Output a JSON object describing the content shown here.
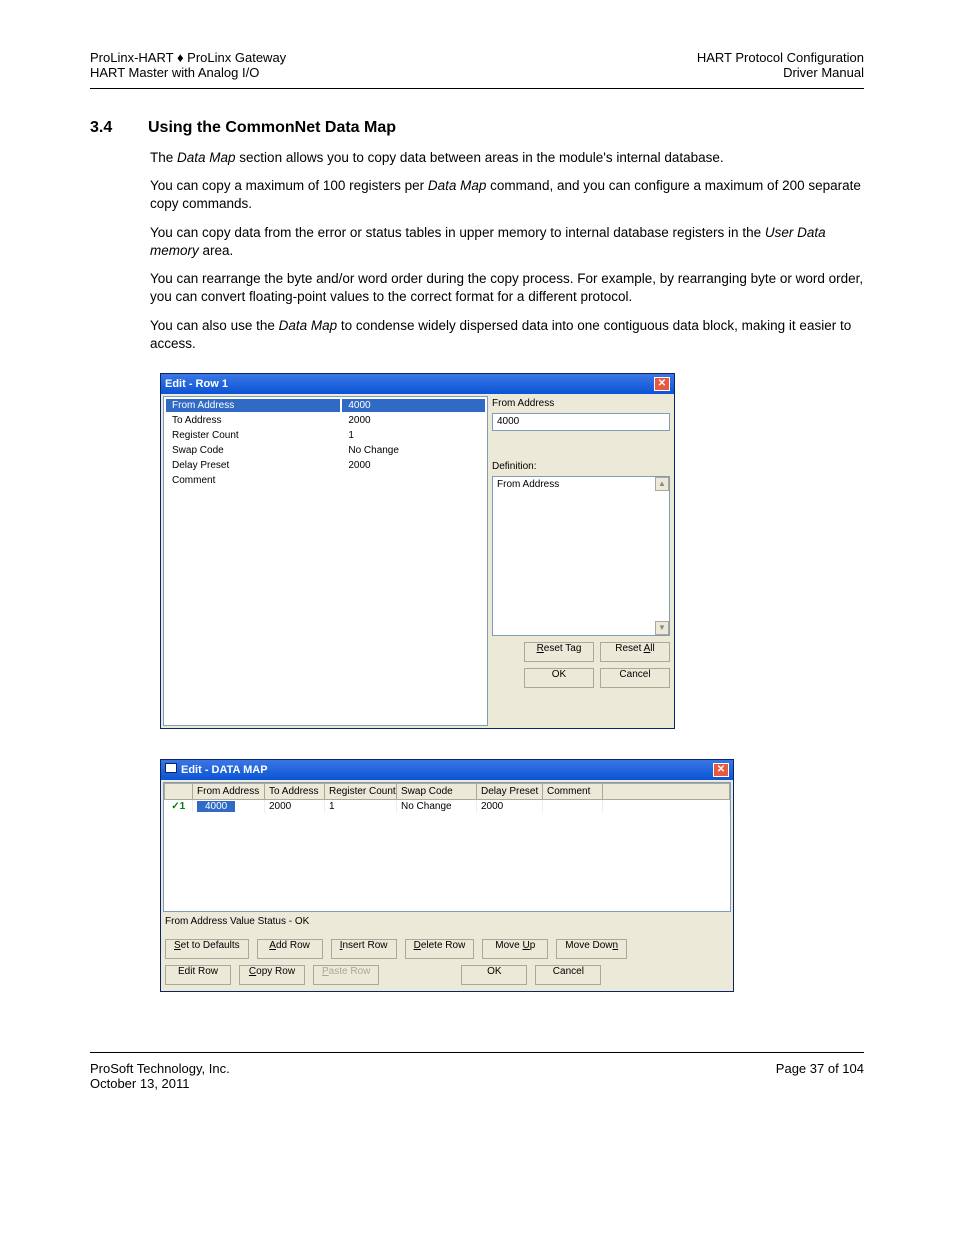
{
  "header": {
    "left1": "ProLinx-HART ♦ ProLinx Gateway",
    "left2": "HART Master with Analog I/O",
    "right1": "HART Protocol Configuration",
    "right2": "Driver Manual"
  },
  "section": {
    "num": "3.4",
    "title": "Using the CommonNet Data Map",
    "p1a": "The ",
    "p1b": "Data Map",
    "p1c": " section allows you to copy data between areas in the module's internal database.",
    "p2a": "You can copy a maximum of 100 registers per ",
    "p2b": "Data Map",
    "p2c": " command, and you can configure a maximum of 200 separate copy commands.",
    "p3a": "You can copy data from the error or status tables in upper memory to internal database registers in the ",
    "p3b": "User Data memory",
    "p3c": " area.",
    "p4": "You can rearrange the byte and/or word order during the copy process. For example, by rearranging byte or word order, you can convert floating-point values to the correct format for a different protocol.",
    "p5a": "You can also use the ",
    "p5b": "Data Map",
    "p5c": " to condense widely dispersed data into one contiguous data block, making it easier to access."
  },
  "dlg1": {
    "title": "Edit - Row 1",
    "props": [
      {
        "k": "From Address",
        "v": "4000"
      },
      {
        "k": "To Address",
        "v": "2000"
      },
      {
        "k": "Register Count",
        "v": "1"
      },
      {
        "k": "Swap Code",
        "v": "No Change"
      },
      {
        "k": "Delay Preset",
        "v": "2000"
      },
      {
        "k": "Comment",
        "v": ""
      }
    ],
    "field_label": "From Address",
    "field_value": "4000",
    "def_label": "Definition:",
    "def_value": "From Address",
    "btn_reset_tag": "Reset Tag",
    "btn_reset_all": "Reset All",
    "btn_ok": "OK",
    "btn_cancel": "Cancel"
  },
  "dlg2": {
    "title": "Edit - DATA MAP",
    "cols": [
      "",
      "From Address",
      "To Address",
      "Register Count",
      "Swap Code",
      "Delay Preset",
      "Comment",
      ""
    ],
    "row": {
      "n": "1",
      "from": "4000",
      "to": "2000",
      "reg": "1",
      "swap": "No Change",
      "delay": "2000",
      "comment": ""
    },
    "status": "From Address Value Status - OK",
    "btns1": {
      "set": "Set to Defaults",
      "add": "Add Row",
      "insert": "Insert Row",
      "delete": "Delete Row",
      "up": "Move Up",
      "down": "Move Down"
    },
    "btns2": {
      "edit": "Edit Row",
      "copy": "Copy Row",
      "paste": "Paste Row",
      "ok": "OK",
      "cancel": "Cancel"
    }
  },
  "footer": {
    "left1": "ProSoft Technology, Inc.",
    "left2": "October 13, 2011",
    "right": "Page 37 of 104"
  }
}
